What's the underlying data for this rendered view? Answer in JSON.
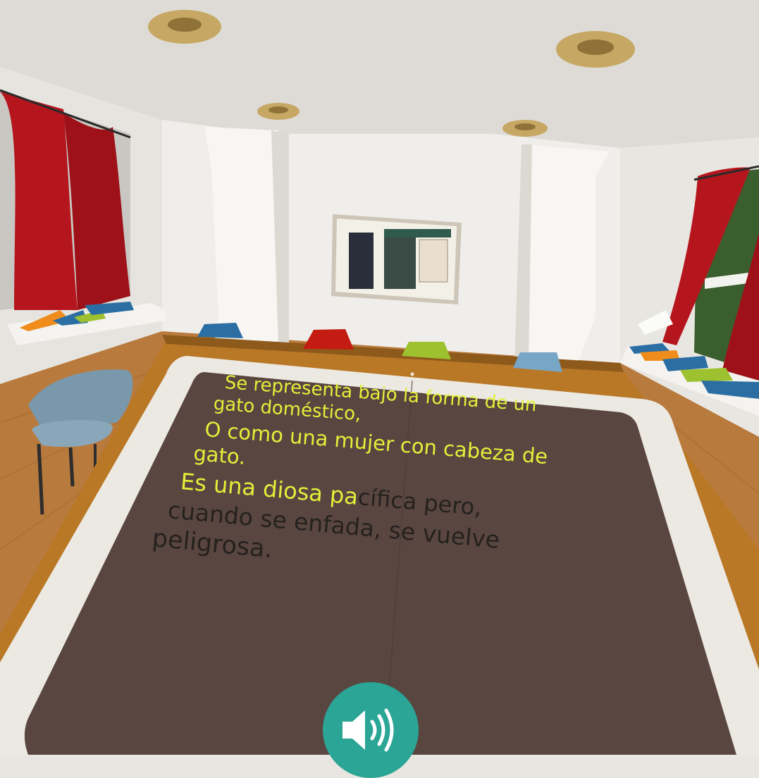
{
  "tablet": {
    "lines": [
      {
        "highlighted": "Se representa bajo la forma de un",
        "rest": ""
      },
      {
        "highlighted": "gato doméstico,",
        "rest": ""
      },
      {
        "highlighted": "O como una mujer con cabeza de",
        "rest": ""
      },
      {
        "highlighted": "gato.",
        "rest": ""
      },
      {
        "highlighted": "Es una diosa pa",
        "rest": "cífica pero,"
      },
      {
        "highlighted": "",
        "rest": "cuando se enfada, se vuelve"
      },
      {
        "highlighted": "",
        "rest": "peligrosa."
      }
    ],
    "audio_icon": "speaker-volume-icon"
  },
  "colors": {
    "highlight_text": "#e1f03a",
    "normal_text": "#25211f",
    "tablet_screen": "#5a4640",
    "tablet_frame": "#ece9e3",
    "audio_button": "#2aa596",
    "curtain": "#b5161d",
    "floor": "#b87a3d"
  }
}
